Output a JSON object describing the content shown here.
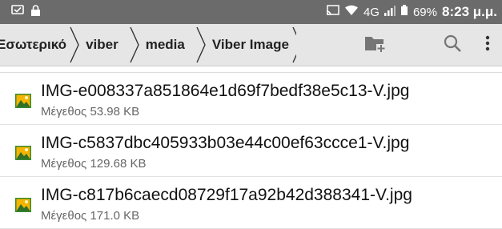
{
  "status_bar": {
    "battery": "69%",
    "time": "8:23 μ.μ.",
    "network": "4G"
  },
  "breadcrumbs": [
    {
      "label": "Εσωτερικό"
    },
    {
      "label": "viber"
    },
    {
      "label": "media"
    },
    {
      "label": "Viber Image"
    }
  ],
  "toolbar": {
    "icons": [
      "new-folder-icon",
      "search-icon",
      "more-vert-icon"
    ]
  },
  "files": [
    {
      "name": "IMG-e008337a851864e1d69f7bedf38e5c13-V.jpg",
      "size": "Μέγεθος 53.98 KB",
      "icon": "image-file-icon"
    },
    {
      "name": "IMG-c5837dbc405933b03e44c00ef63ccce1-V.jpg",
      "size": "Μέγεθος 129.68 KB",
      "icon": "image-file-icon"
    },
    {
      "name": "IMG-c817b6caecd08729f17a92b42d388341-V.jpg",
      "size": "Μέγεθος 171.0 KB",
      "icon": "image-file-icon"
    }
  ],
  "colors": {
    "status_bar": "#6b6b6b",
    "toolbar": "#e6e6e6"
  }
}
